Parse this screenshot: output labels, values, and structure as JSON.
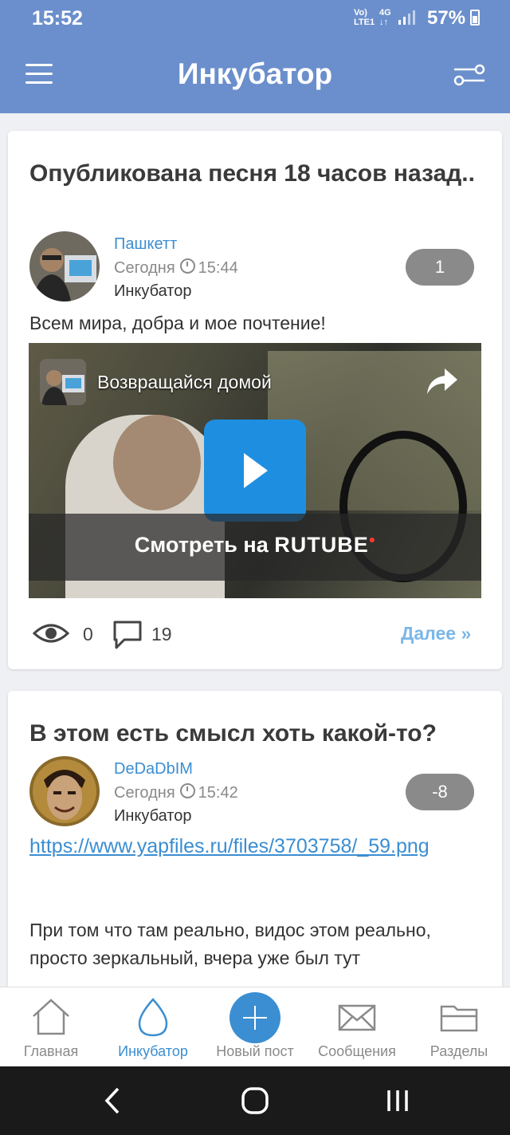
{
  "status_bar": {
    "time": "15:52",
    "network": "Vo) 4G",
    "network_sub": "LTE1",
    "battery": "57%"
  },
  "app_bar": {
    "title": "Инкубатор"
  },
  "posts": [
    {
      "title": "Опубликована песня 18 часов назад..",
      "author": "Пашкетт",
      "date": "Сегодня",
      "time": "15:44",
      "section": "Инкубатор",
      "rating": "1",
      "text": "Всем мира, добра и мое почтение!",
      "video": {
        "title": "Возвращайся домой",
        "watch_label": "Смотреть на",
        "platform": "RUTUBE"
      },
      "views": "0",
      "comments": "19",
      "more": "Далее »"
    },
    {
      "title": "В этом есть смысл хоть какой-то?",
      "author": "DeDaDbIM",
      "date": "Сегодня",
      "time": "15:42",
      "section": "Инкубатор",
      "rating": "-8",
      "link_text": "https://www.yapfiles.ru/files/3703758/_59.png",
      "text": "При том что там реально, видос этом реально, просто зеркальный, вчера уже был тут"
    }
  ],
  "bottom_nav": [
    {
      "label": "Главная",
      "icon": "home-icon"
    },
    {
      "label": "Инкубатор",
      "icon": "egg-icon",
      "active": true
    },
    {
      "label": "Новый пост",
      "icon": "plus-icon"
    },
    {
      "label": "Сообщения",
      "icon": "envelope-icon"
    },
    {
      "label": "Разделы",
      "icon": "folder-icon"
    }
  ],
  "colors": {
    "primary": "#6b8fcc",
    "accent": "#3b8ed1",
    "rating_bg": "#8a8a8a"
  }
}
